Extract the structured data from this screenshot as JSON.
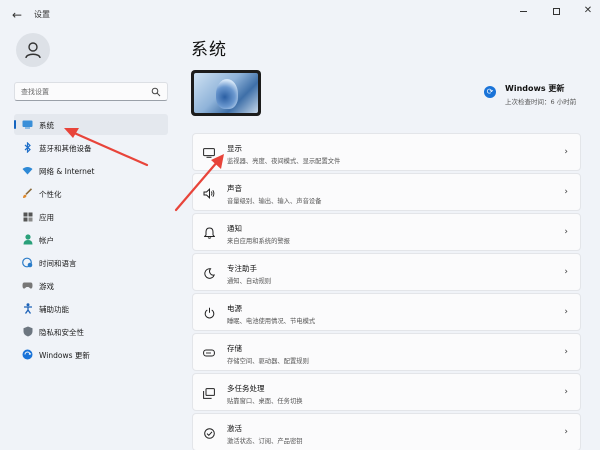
{
  "window": {
    "title": "设置",
    "back_glyph": "←",
    "close_glyph": "✕"
  },
  "sidebar": {
    "search": {
      "placeholder": "查找设置"
    },
    "items": [
      {
        "label": "系统",
        "icon": "monitor-icon",
        "active": true
      },
      {
        "label": "蓝牙和其他设备",
        "icon": "bluetooth-icon",
        "active": false
      },
      {
        "label": "网络 & Internet",
        "icon": "wifi-icon",
        "active": false
      },
      {
        "label": "个性化",
        "icon": "brush-icon",
        "active": false
      },
      {
        "label": "应用",
        "icon": "apps-icon",
        "active": false
      },
      {
        "label": "帐户",
        "icon": "account-icon",
        "active": false
      },
      {
        "label": "时间和语言",
        "icon": "globe-clock-icon",
        "active": false
      },
      {
        "label": "游戏",
        "icon": "gamepad-icon",
        "active": false
      },
      {
        "label": "辅助功能",
        "icon": "accessibility-icon",
        "active": false
      },
      {
        "label": "隐私和安全性",
        "icon": "shield-icon",
        "active": false
      },
      {
        "label": "Windows 更新",
        "icon": "windows-update-icon",
        "active": false
      }
    ]
  },
  "main": {
    "title": "系统",
    "update": {
      "title": "Windows 更新",
      "subtitle": "上次检查时间：6 小时前"
    },
    "cards": [
      {
        "title": "显示",
        "desc": "监视器、亮度、夜间模式、显示配置文件",
        "icon": "display-icon"
      },
      {
        "title": "声音",
        "desc": "音量级别、输出、输入、声音设备",
        "icon": "speaker-icon"
      },
      {
        "title": "通知",
        "desc": "来自应用和系统的警报",
        "icon": "bell-icon"
      },
      {
        "title": "专注助手",
        "desc": "通知、自动规则",
        "icon": "moon-icon"
      },
      {
        "title": "电源",
        "desc": "睡眠、电池使用情况、节电模式",
        "icon": "power-icon"
      },
      {
        "title": "存储",
        "desc": "存储空间、驱动器、配置规则",
        "icon": "storage-icon"
      },
      {
        "title": "多任务处理",
        "desc": "贴靠窗口、桌面、任务切换",
        "icon": "multitask-icon"
      },
      {
        "title": "激活",
        "desc": "激活状态、订阅、产品密钥",
        "icon": "activation-icon"
      }
    ],
    "chevron": "›"
  },
  "colors": {
    "accent": "#1565c0",
    "background": "#f0f3f8",
    "card": "#fbfbfc",
    "annotation": "#e8443a"
  }
}
